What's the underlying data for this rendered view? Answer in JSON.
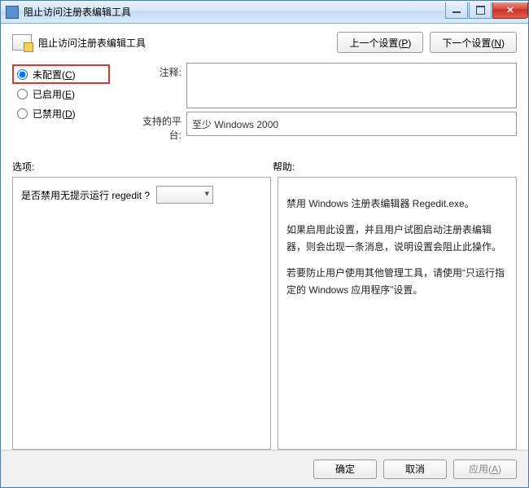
{
  "window": {
    "title": "阻止访问注册表编辑工具"
  },
  "header": {
    "policy_title": "阻止访问注册表编辑工具",
    "prev_btn": "上一个设置(",
    "prev_key": "P",
    "prev_btn_tail": ")",
    "next_btn": "下一个设置(",
    "next_key": "N",
    "next_btn_tail": ")"
  },
  "radios": {
    "not_configured": "未配置(",
    "not_configured_key": "C",
    "not_configured_tail": ")",
    "enabled": "已启用(",
    "enabled_key": "E",
    "enabled_tail": ")",
    "disabled": "已禁用(",
    "disabled_key": "D",
    "disabled_tail": ")"
  },
  "labels": {
    "comment": "注释:",
    "platform": "支持的平台:",
    "options": "选项:",
    "help": "帮助:"
  },
  "fields": {
    "comment_value": "",
    "platform_value": "至少 Windows 2000"
  },
  "options": {
    "question": "是否禁用无提示运行 regedit ?",
    "combo_value": ""
  },
  "help": {
    "p1": "禁用 Windows 注册表编辑器 Regedit.exe。",
    "p2": "如果启用此设置，并且用户试图启动注册表编辑器，则会出现一条消息，说明设置会阻止此操作。",
    "p3": "若要防止用户使用其他管理工具，请使用“只运行指定的 Windows 应用程序”设置。"
  },
  "footer": {
    "ok": "确定",
    "cancel": "取消",
    "apply": "应用(",
    "apply_key": "A",
    "apply_tail": ")"
  }
}
